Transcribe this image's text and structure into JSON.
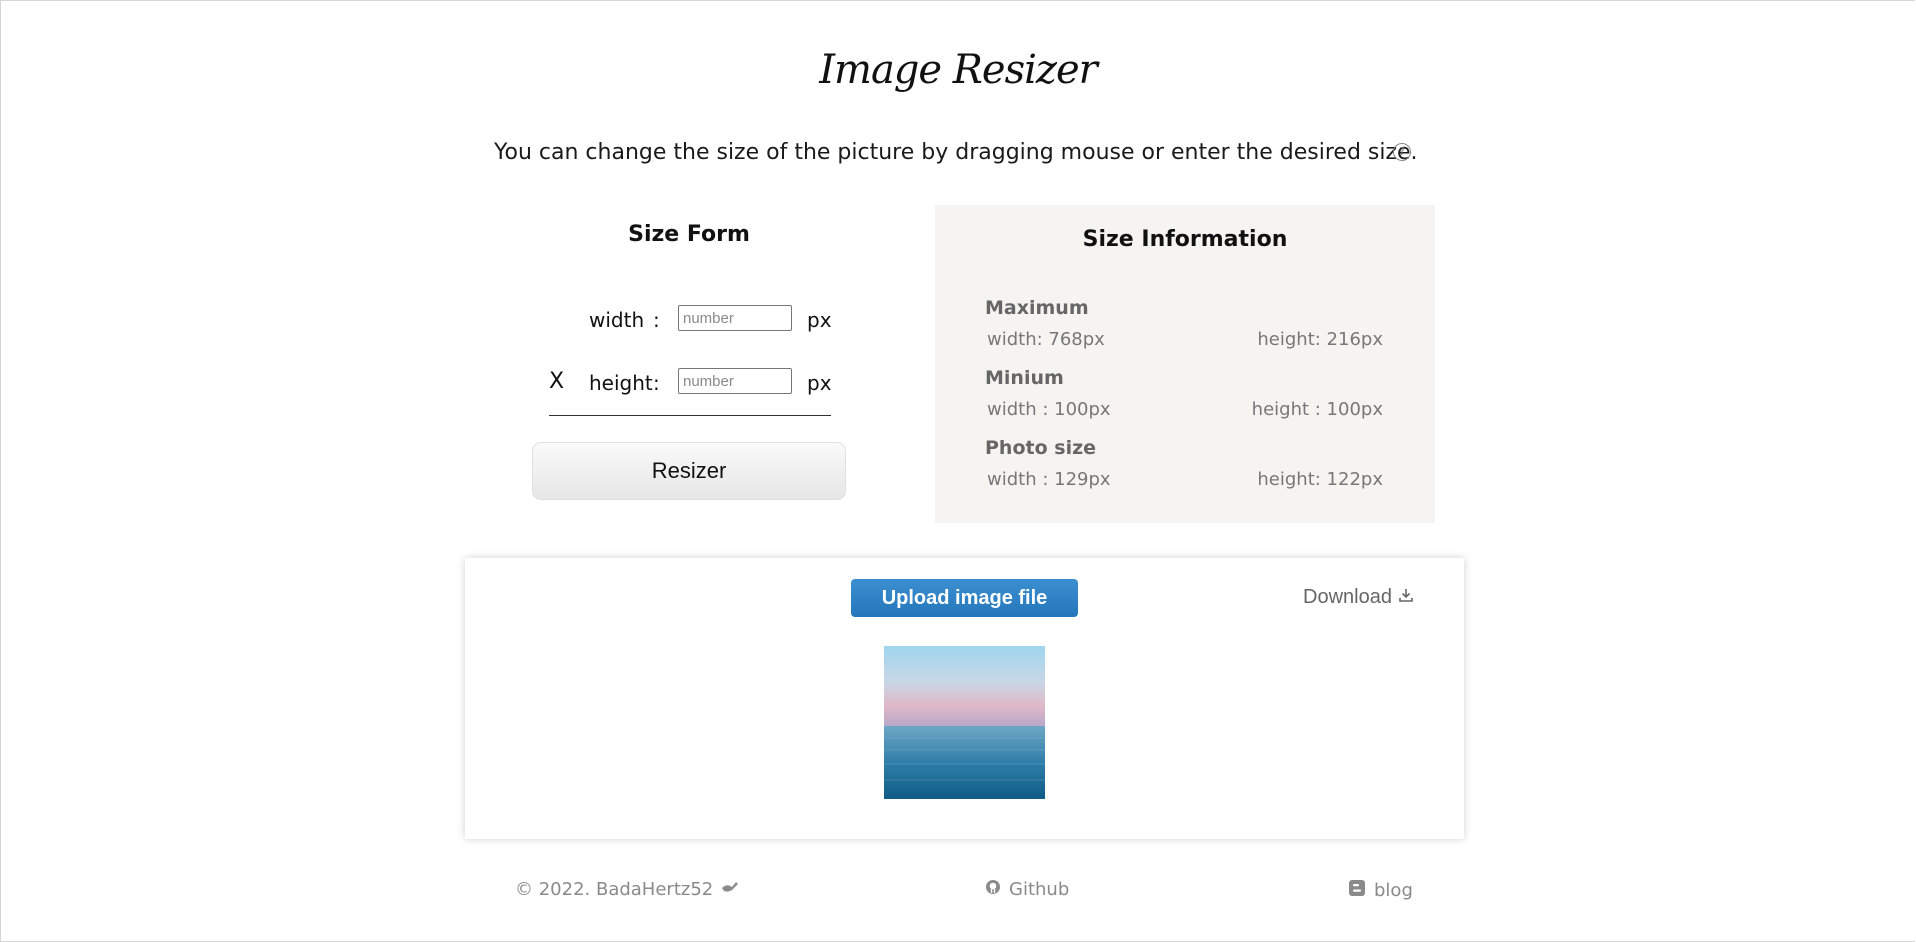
{
  "header": {
    "title": "Image Resizer",
    "subtitle": "You can change the size of the picture by dragging mouse or enter the desired size.",
    "help_icon": "question-circle-icon"
  },
  "size_form": {
    "title": "Size Form",
    "width_label": "width",
    "width_colon": ":",
    "width_placeholder": "number",
    "width_unit": "px",
    "height_label": "height",
    "height_colon": ":",
    "height_placeholder": "number",
    "height_unit": "px",
    "multiply_symbol": "X",
    "resize_button": "Resizer"
  },
  "size_info": {
    "title": "Size Information",
    "maximum": {
      "title": "Maximum",
      "width": "width:  768px",
      "height": "height:  216px"
    },
    "minimum": {
      "title": "Minium",
      "width": "width :  100px",
      "height": "height :  100px"
    },
    "photo": {
      "title": "Photo size",
      "width": "width :  129px",
      "height": "height:  122px"
    }
  },
  "upload": {
    "button": "Upload image file",
    "download": "Download",
    "download_icon": "download-icon"
  },
  "footer": {
    "copyright": "© 2022. BadaHertz52",
    "github": "Github",
    "blog": "blog"
  },
  "colors": {
    "accent": "#2a7fc4",
    "panel_bg": "#f5f4f1"
  }
}
